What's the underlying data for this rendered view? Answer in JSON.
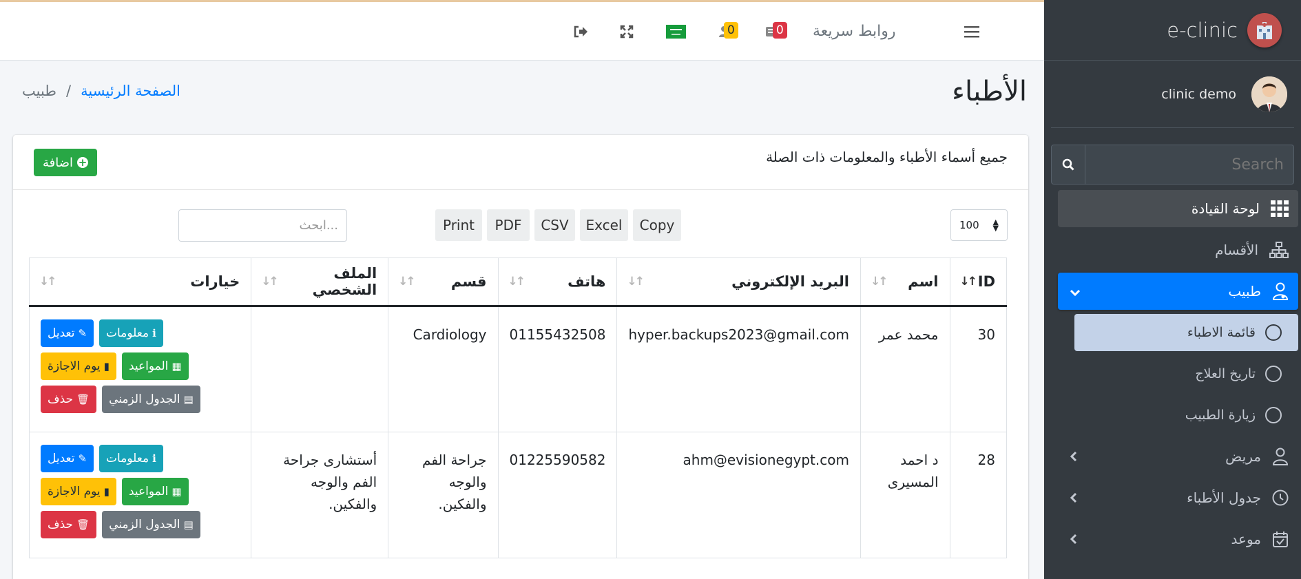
{
  "brand": {
    "name": "e-clinic"
  },
  "user": {
    "name": "clinic demo"
  },
  "sidebar": {
    "search_placeholder": "Search",
    "items": [
      {
        "label": "لوحة القيادة"
      },
      {
        "label": "الأقسام"
      },
      {
        "label": "طبيب"
      },
      {
        "label": "مريض"
      },
      {
        "label": "جدول الأطباء"
      },
      {
        "label": "موعد"
      }
    ],
    "doctor_sub": [
      {
        "label": "قائمة الاطباء"
      },
      {
        "label": "تاريخ العلاج"
      },
      {
        "label": "زيارة الطبيب"
      }
    ]
  },
  "navbar": {
    "quick_links": "روابط سريعة",
    "messages_count": "0",
    "notifications_count": "0"
  },
  "page": {
    "title": "الأطباء",
    "breadcrumb_home": "الصفحة الرئيسية",
    "breadcrumb_sep": "/",
    "breadcrumb_current": "طبيب"
  },
  "card": {
    "title": "جميع أسماء الأطباء والمعلومات ذات الصلة",
    "add_label": "اضافة"
  },
  "table_controls": {
    "page_length": "100",
    "search_placeholder": "ابحث...",
    "export": [
      "Copy",
      "Excel",
      "CSV",
      "PDF",
      "Print"
    ]
  },
  "table": {
    "headers": [
      "ID",
      "اسم",
      "البريد الإلكتروني",
      "هاتف",
      "قسم",
      "الملف الشخصي",
      "خيارات"
    ],
    "rows": [
      {
        "id": "30",
        "name": "محمد عمر",
        "email": "hyper.backups2023@gmail.com",
        "phone": "01155432508",
        "dept": "Cardiology",
        "profile": ""
      },
      {
        "id": "28",
        "name": "د احمد المسيرى",
        "email": "ahm@evisionegypt.com",
        "phone": "01225590582",
        "dept": "جراحة الفم والوجه والفكين.",
        "profile": "أستشارى جراحة الفم والوجه والفكين."
      }
    ],
    "actions": {
      "info": "معلومات",
      "edit": "تعديل",
      "appointments": "المواعيد",
      "holiday": "يوم الاجازة",
      "schedule": "الجدول الزمني",
      "delete": "حذف"
    }
  },
  "colors": {
    "primary": "#007bff",
    "success": "#28a745",
    "info": "#17a2b8",
    "warning": "#ffc107",
    "danger": "#dc3545",
    "secondary": "#6c757d",
    "sidebar": "#343a40"
  }
}
